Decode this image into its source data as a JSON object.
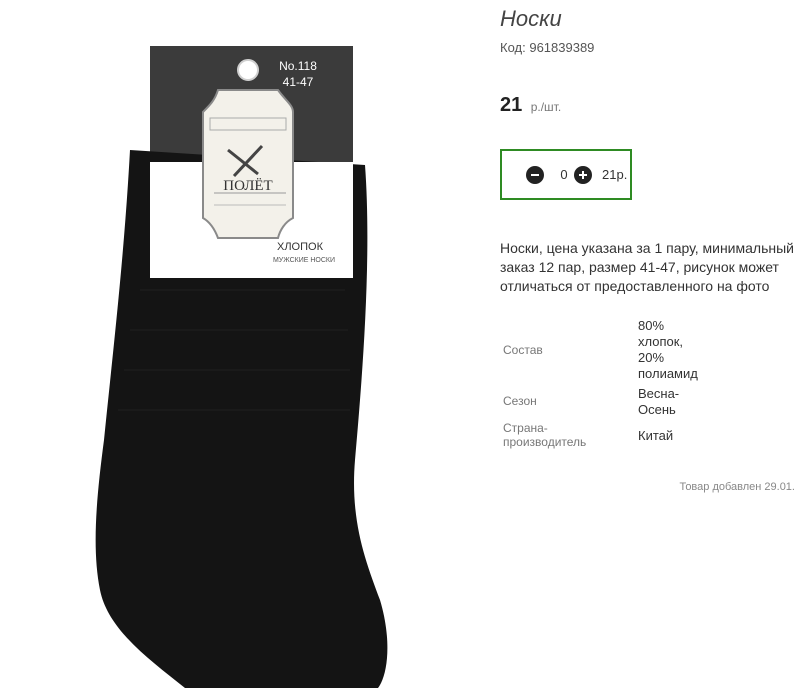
{
  "product": {
    "title": "Носки",
    "code_label": "Код:",
    "code_value": "961839389",
    "price_value": "21",
    "price_unit": "р./шт.",
    "quantity": "0",
    "quantity_total": "21р.",
    "description": "Носки, цена указана за 1 пару, минимальный заказ 12 пар, размер 41-47, рисунок может отличаться от предоставленного на фото",
    "added_text": "Товар добавлен 29.01."
  },
  "label": {
    "model": "No.118",
    "size": "41-47",
    "brand": "ПОЛЁТ",
    "material": "ХЛОПОК",
    "subtitle": "МУЖСКИЕ НОСКИ"
  },
  "specs": [
    {
      "label": "Состав",
      "value_lines": [
        "80%",
        "хлопок,",
        "20%",
        "полиамид"
      ]
    },
    {
      "label": "Сезон",
      "value_lines": [
        "Весна-",
        "Осень"
      ]
    },
    {
      "label_lines": [
        "Страна-",
        "производитель"
      ],
      "value_lines": [
        "Китай"
      ]
    }
  ],
  "icons": {
    "minus": "minus-circle-icon",
    "plus": "plus-circle-icon"
  },
  "colors": {
    "accent_border": "#2e8b23",
    "sock": "#141414",
    "card": "#3a3a3a"
  }
}
